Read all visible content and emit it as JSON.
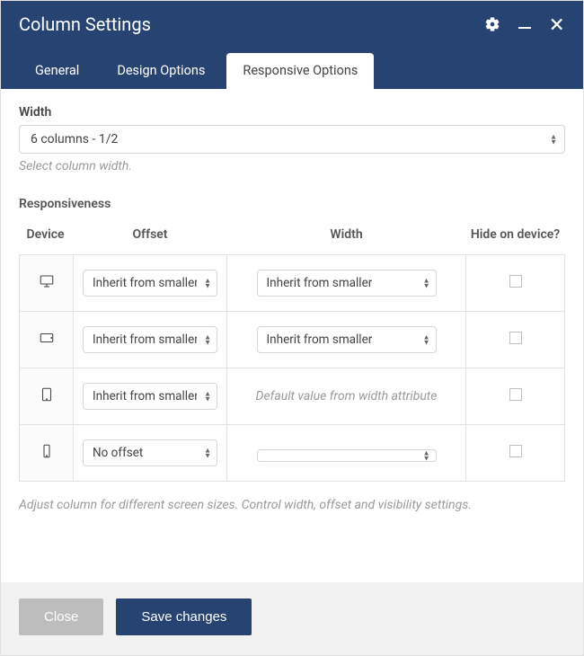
{
  "header": {
    "title": "Column Settings",
    "icons": {
      "gear": "gear-icon",
      "minimize": "minimize-icon",
      "close": "close-icon"
    }
  },
  "tabs": [
    {
      "label": "General",
      "active": false
    },
    {
      "label": "Design Options",
      "active": false
    },
    {
      "label": "Responsive Options",
      "active": true
    }
  ],
  "width": {
    "label": "Width",
    "value": "6 columns - 1/2",
    "helper": "Select column width."
  },
  "responsiveness": {
    "label": "Responsiveness",
    "columns": {
      "device": "Device",
      "offset": "Offset",
      "width": "Width",
      "hide": "Hide on device?"
    },
    "rows": [
      {
        "device": "desktop",
        "offset": "Inherit from smaller",
        "width_type": "select",
        "width": "Inherit from smaller",
        "hide": false
      },
      {
        "device": "tablet-landscape",
        "offset": "Inherit from smaller",
        "width_type": "select",
        "width": "Inherit from smaller",
        "hide": false
      },
      {
        "device": "tablet",
        "offset": "Inherit from smaller",
        "width_type": "text",
        "width_text": "Default value from width attribute",
        "hide": false
      },
      {
        "device": "phone",
        "offset": "No offset",
        "width_type": "select",
        "width": "",
        "hide": false
      }
    ],
    "helper": "Adjust column for different screen sizes. Control width, offset and visibility settings."
  },
  "footer": {
    "close": "Close",
    "save": "Save changes"
  }
}
